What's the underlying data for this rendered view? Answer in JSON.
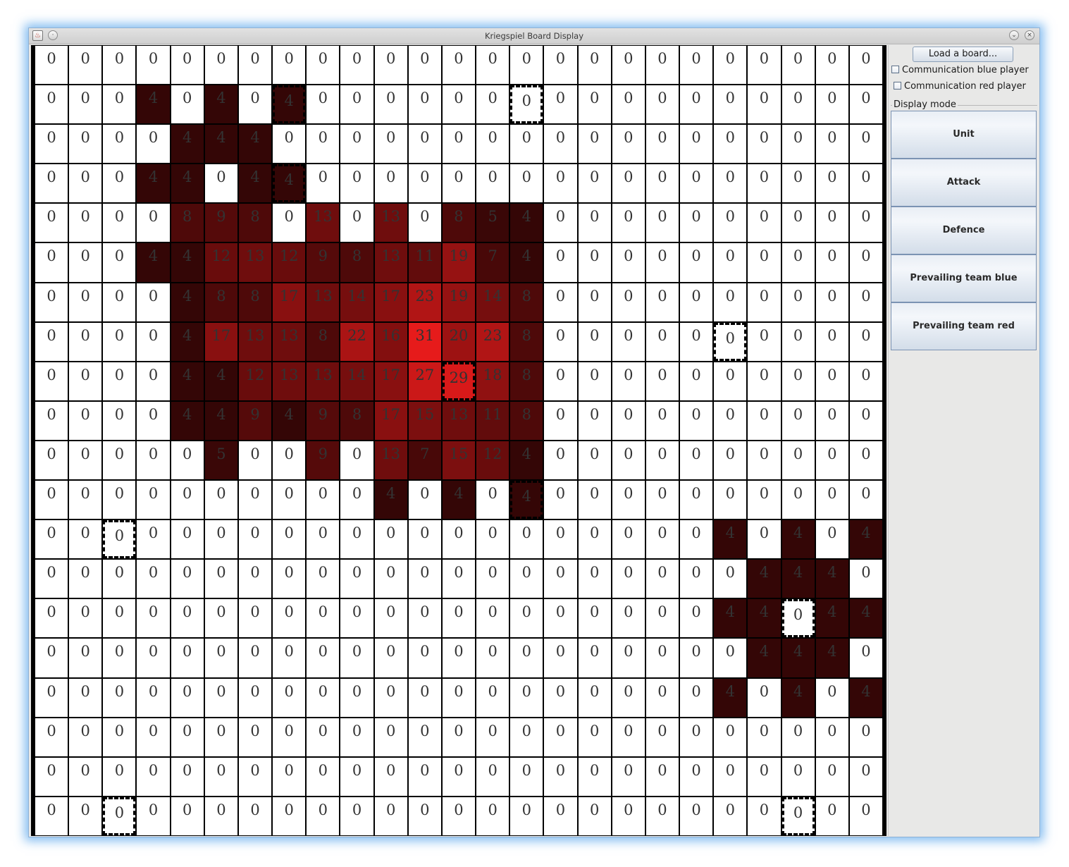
{
  "window": {
    "title": "Kriegspiel Board Display"
  },
  "panel": {
    "load_button": "Load a board...",
    "checkboxes": [
      {
        "label": "Communication blue player",
        "checked": false
      },
      {
        "label": "Communication red player",
        "checked": false
      }
    ],
    "display_mode_label": "Display mode",
    "mode_buttons": [
      "Unit",
      "Attack",
      "Defence",
      "Prevailing team blue",
      "Prevailing team red"
    ]
  },
  "colors": {
    "heat_base": "#ff0000",
    "grid_line": "#000000",
    "window_glow": "#5aa5eb"
  },
  "board": {
    "rows": 20,
    "cols": 25,
    "max_value": 31,
    "values": [
      [
        0,
        0,
        0,
        0,
        0,
        0,
        0,
        0,
        0,
        0,
        0,
        0,
        0,
        0,
        0,
        0,
        0,
        0,
        0,
        0,
        0,
        0,
        0,
        0,
        0
      ],
      [
        0,
        0,
        0,
        4,
        0,
        4,
        0,
        4,
        0,
        0,
        0,
        0,
        0,
        0,
        0,
        0,
        0,
        0,
        0,
        0,
        0,
        0,
        0,
        0,
        0
      ],
      [
        0,
        0,
        0,
        0,
        4,
        4,
        4,
        0,
        0,
        0,
        0,
        0,
        0,
        0,
        0,
        0,
        0,
        0,
        0,
        0,
        0,
        0,
        0,
        0,
        0
      ],
      [
        0,
        0,
        0,
        4,
        4,
        0,
        4,
        4,
        0,
        0,
        0,
        0,
        0,
        0,
        0,
        0,
        0,
        0,
        0,
        0,
        0,
        0,
        0,
        0,
        0
      ],
      [
        0,
        0,
        0,
        0,
        8,
        9,
        8,
        0,
        13,
        0,
        13,
        0,
        8,
        5,
        4,
        0,
        0,
        0,
        0,
        0,
        0,
        0,
        0,
        0,
        0
      ],
      [
        0,
        0,
        0,
        4,
        4,
        12,
        13,
        12,
        9,
        8,
        13,
        11,
        19,
        7,
        4,
        0,
        0,
        0,
        0,
        0,
        0,
        0,
        0,
        0,
        0
      ],
      [
        0,
        0,
        0,
        0,
        4,
        8,
        8,
        17,
        13,
        14,
        17,
        23,
        19,
        14,
        8,
        0,
        0,
        0,
        0,
        0,
        0,
        0,
        0,
        0,
        0
      ],
      [
        0,
        0,
        0,
        0,
        4,
        17,
        13,
        13,
        8,
        22,
        16,
        31,
        20,
        23,
        8,
        0,
        0,
        0,
        0,
        0,
        0,
        0,
        0,
        0,
        0
      ],
      [
        0,
        0,
        0,
        0,
        4,
        4,
        12,
        13,
        13,
        14,
        17,
        27,
        29,
        18,
        8,
        0,
        0,
        0,
        0,
        0,
        0,
        0,
        0,
        0,
        0
      ],
      [
        0,
        0,
        0,
        0,
        4,
        4,
        9,
        4,
        9,
        8,
        17,
        15,
        13,
        11,
        8,
        0,
        0,
        0,
        0,
        0,
        0,
        0,
        0,
        0,
        0
      ],
      [
        0,
        0,
        0,
        0,
        0,
        5,
        0,
        0,
        9,
        0,
        13,
        7,
        15,
        12,
        4,
        0,
        0,
        0,
        0,
        0,
        0,
        0,
        0,
        0,
        0
      ],
      [
        0,
        0,
        0,
        0,
        0,
        0,
        0,
        0,
        0,
        0,
        4,
        0,
        4,
        0,
        4,
        0,
        0,
        0,
        0,
        0,
        0,
        0,
        0,
        0,
        0
      ],
      [
        0,
        0,
        0,
        0,
        0,
        0,
        0,
        0,
        0,
        0,
        0,
        0,
        0,
        0,
        0,
        0,
        0,
        0,
        0,
        0,
        4,
        0,
        4,
        0,
        4
      ],
      [
        0,
        0,
        0,
        0,
        0,
        0,
        0,
        0,
        0,
        0,
        0,
        0,
        0,
        0,
        0,
        0,
        0,
        0,
        0,
        0,
        0,
        4,
        4,
        4,
        0
      ],
      [
        0,
        0,
        0,
        0,
        0,
        0,
        0,
        0,
        0,
        0,
        0,
        0,
        0,
        0,
        0,
        0,
        0,
        0,
        0,
        0,
        4,
        4,
        0,
        4,
        4
      ],
      [
        0,
        0,
        0,
        0,
        0,
        0,
        0,
        0,
        0,
        0,
        0,
        0,
        0,
        0,
        0,
        0,
        0,
        0,
        0,
        0,
        0,
        4,
        4,
        4,
        0
      ],
      [
        0,
        0,
        0,
        0,
        0,
        0,
        0,
        0,
        0,
        0,
        0,
        0,
        0,
        0,
        0,
        0,
        0,
        0,
        0,
        0,
        4,
        0,
        4,
        0,
        4
      ],
      [
        0,
        0,
        0,
        0,
        0,
        0,
        0,
        0,
        0,
        0,
        0,
        0,
        0,
        0,
        0,
        0,
        0,
        0,
        0,
        0,
        0,
        0,
        0,
        0,
        0
      ],
      [
        0,
        0,
        0,
        0,
        0,
        0,
        0,
        0,
        0,
        0,
        0,
        0,
        0,
        0,
        0,
        0,
        0,
        0,
        0,
        0,
        0,
        0,
        0,
        0,
        0
      ],
      [
        0,
        0,
        0,
        0,
        0,
        0,
        0,
        0,
        0,
        0,
        0,
        0,
        0,
        0,
        0,
        0,
        0,
        0,
        0,
        0,
        0,
        0,
        0,
        0,
        0
      ]
    ],
    "unit_cells": [
      [
        1,
        7
      ],
      [
        1,
        14
      ],
      [
        3,
        7
      ],
      [
        7,
        20
      ],
      [
        8,
        12
      ],
      [
        11,
        14
      ],
      [
        12,
        2
      ],
      [
        14,
        22
      ],
      [
        19,
        2
      ],
      [
        19,
        22
      ]
    ]
  }
}
